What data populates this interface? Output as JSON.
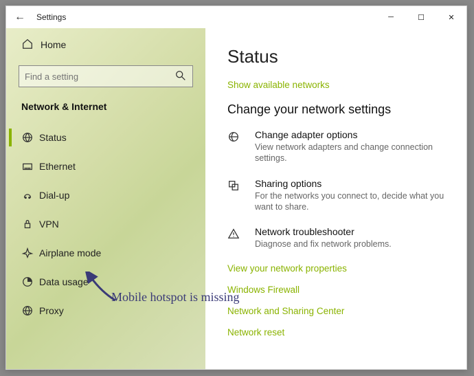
{
  "window": {
    "title": "Settings"
  },
  "sidebar": {
    "home": "Home",
    "search_placeholder": "Find a setting",
    "category": "Network & Internet",
    "items": [
      {
        "label": "Status",
        "selected": true
      },
      {
        "label": "Ethernet"
      },
      {
        "label": "Dial-up"
      },
      {
        "label": "VPN"
      },
      {
        "label": "Airplane mode"
      },
      {
        "label": "Data usage"
      },
      {
        "label": "Proxy"
      }
    ]
  },
  "main": {
    "heading": "Status",
    "show_networks": "Show available networks",
    "change_heading": "Change your network settings",
    "options": [
      {
        "label": "Change adapter options",
        "desc": "View network adapters and change connection settings."
      },
      {
        "label": "Sharing options",
        "desc": "For the networks you connect to, decide what you want to share."
      },
      {
        "label": "Network troubleshooter",
        "desc": "Diagnose and fix network problems."
      }
    ],
    "links": [
      "View your network properties",
      "Windows Firewall",
      "Network and Sharing Center",
      "Network reset"
    ]
  },
  "annotation": "Mobile hotspot is missing"
}
